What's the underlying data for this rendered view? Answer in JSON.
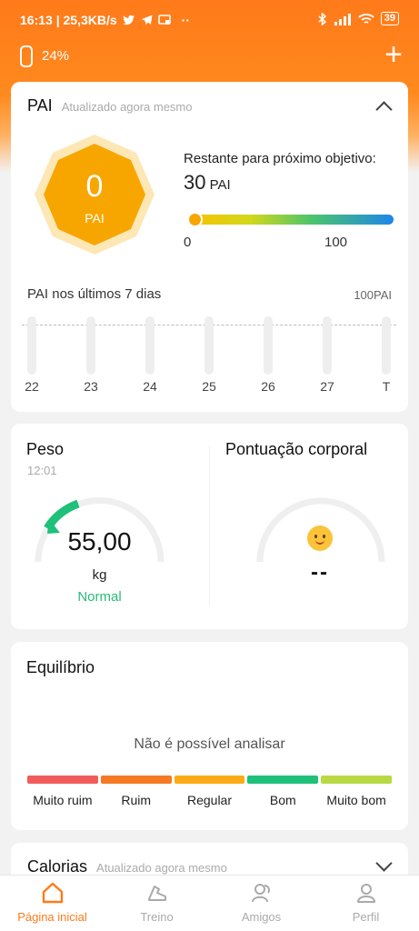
{
  "status_bar": {
    "time_speed": "16:13 | 25,3KB/s",
    "battery": "39"
  },
  "device": {
    "battery_percent": "24%"
  },
  "colors": {
    "accent": "#ff7a1a",
    "pai_hex": "#f7a600",
    "normal_green": "#2bba7a"
  },
  "pai_card": {
    "title": "PAI",
    "subtitle": "Atualizado agora mesmo",
    "value": "0",
    "unit": "PAI",
    "remaining_prefix": "Restante para próximo objetivo:",
    "remaining_value": "30",
    "remaining_unit": "PAI",
    "bar_min": "0",
    "bar_max": "100",
    "week_title": "PAI nos últimos 7 dias",
    "week_max": "100PAI",
    "days": [
      "22",
      "23",
      "24",
      "25",
      "26",
      "27",
      "T"
    ]
  },
  "weight_card": {
    "title": "Peso",
    "time": "12:01",
    "value": "55,00",
    "unit": "kg",
    "status": "Normal",
    "gauge_level": 0.08
  },
  "body_card": {
    "title": "Pontuação corporal",
    "value": "--",
    "icon": "smiley-face-icon"
  },
  "balance_card": {
    "title": "Equilíbrio",
    "message": "Não é possível analisar",
    "levels": [
      {
        "label": "Muito ruim",
        "color": "#f25b5b"
      },
      {
        "label": "Ruim",
        "color": "#f57a23"
      },
      {
        "label": "Regular",
        "color": "#fbab16"
      },
      {
        "label": "Bom",
        "color": "#1ec07a"
      },
      {
        "label": "Muito bom",
        "color": "#b8d943"
      }
    ]
  },
  "calories_card": {
    "title": "Calorias",
    "subtitle": "Atualizado agora mesmo"
  },
  "nav": {
    "home": "Página inicial",
    "workout": "Treino",
    "friends": "Amigos",
    "profile": "Perfil"
  }
}
